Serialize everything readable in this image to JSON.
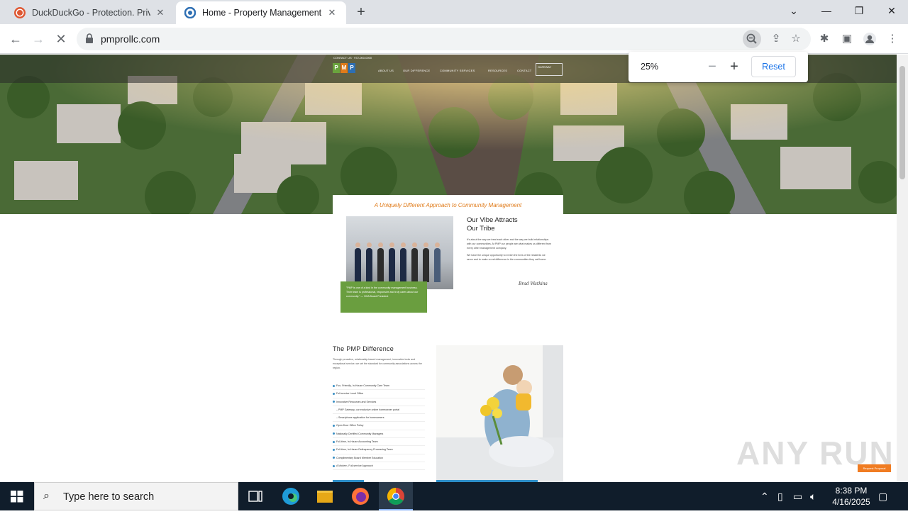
{
  "browser": {
    "tabs": [
      {
        "title": "DuckDuckGo - Protection. Privac",
        "active": false
      },
      {
        "title": "Home - Property Management I",
        "active": true
      }
    ],
    "url": "pmprollc.com",
    "zoom_popup": {
      "level": "25%",
      "minus": "−",
      "plus": "+",
      "reset": "Reset"
    }
  },
  "site": {
    "nav": {
      "topline": "CONTACT US  ·  972-000-0000",
      "logo_letters": [
        "P",
        "M",
        "P"
      ],
      "links": [
        "ABOUT US",
        "OUR DIFFERENCE",
        "COMMUNITY SERVICES",
        "RESOURCES",
        "CONTACT"
      ],
      "gateway": "GATEWAY"
    },
    "tagline": "A Uniquely Different Approach to Community Management",
    "vibe": {
      "title_line1": "Our Vibe Attracts",
      "title_line2": "Our Tribe",
      "paragraph1": "It's about the way we treat each other and the way we build relationships with our communities. At PMP our people are what makes us different from every other management company.",
      "paragraph2": "We have the unique opportunity to enrich the lives of the residents we serve and to make a real difference in the communities they call home."
    },
    "signature": "Brad Watkins",
    "quote": "\"PMP is one of a kind in the community management business. Their team is professional, responsive and truly cares about our community.\" — HOA Board President",
    "difference": {
      "title": "The PMP Difference",
      "intro": "Through proactive, relationship-based management, innovative tools and exceptional service, we set the standard for community associations across the region.",
      "items": [
        {
          "text": "Fun, Friendly, In-House Community Care Team",
          "sub": false
        },
        {
          "text": "Full-service Local Office",
          "sub": false
        },
        {
          "text": "Innovative Resources and Services",
          "sub": false
        },
        {
          "text": "PMP Gateway, our exclusive online homeowner portal",
          "sub": true
        },
        {
          "text": "Smartphone application for homeowners",
          "sub": true
        },
        {
          "text": "Open Door Office Policy",
          "sub": false
        },
        {
          "text": "Nationally Certified Community Managers",
          "sub": false
        },
        {
          "text": "Full-time, In-House Accounting Team",
          "sub": false
        },
        {
          "text": "Full-time, In-House Delinquency Processing Team",
          "sub": false
        },
        {
          "text": "Complimentary Board Member Education",
          "sub": false
        },
        {
          "text": "A Modern, Full-service Approach",
          "sub": false
        }
      ]
    },
    "request_button": "Request Proposal"
  },
  "watermark": "ANY RUN",
  "taskbar": {
    "search_placeholder": "Type here to search",
    "time": "8:38 PM",
    "date": "4/16/2025"
  },
  "colors": {
    "accent_orange": "#e07b1a",
    "accent_green": "#6a9e3f",
    "accent_blue": "#2e8fc9",
    "chrome_blue": "#1a73e8"
  }
}
